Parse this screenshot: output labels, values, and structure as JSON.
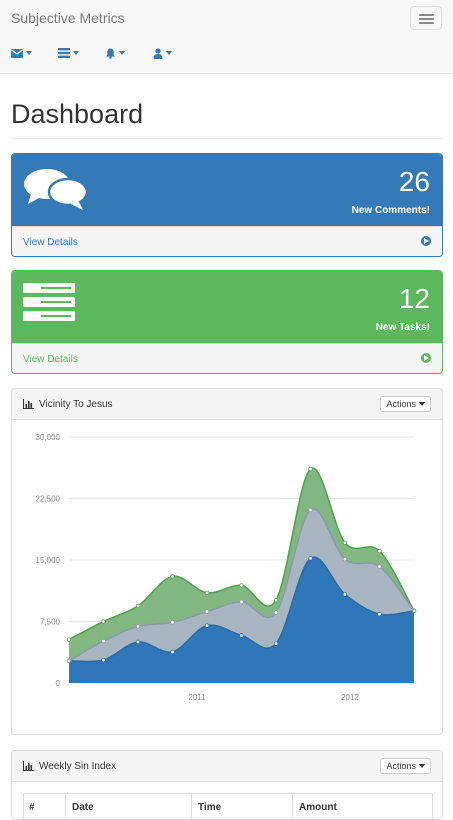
{
  "app": {
    "brand": "Subjective Metrics"
  },
  "nav": {
    "icons": [
      "envelope-icon",
      "tasks-icon",
      "bell-icon",
      "user-icon"
    ]
  },
  "page": {
    "title": "Dashboard"
  },
  "cards": [
    {
      "count": "26",
      "label": "New Comments!",
      "link": "View Details",
      "icon": "comments-icon"
    },
    {
      "count": "12",
      "label": "New Tasks!",
      "link": "View Details",
      "icon": "tasks-icon"
    }
  ],
  "chart_panel": {
    "title": "Vicinity To Jesus",
    "actions_label": "Actions"
  },
  "table_panel": {
    "title": "Weekly Sin Index",
    "actions_label": "Actions",
    "columns": [
      "#",
      "Date",
      "Time",
      "Amount"
    ]
  },
  "colors": {
    "blue": "#337ab7",
    "green": "#5cb85c",
    "area_top": "#7cb47c",
    "area_mid": "#a9b5c3",
    "area_base": "#2f77b8"
  },
  "chart_data": {
    "type": "area",
    "stacked": true,
    "ylim": [
      0,
      30000
    ],
    "yticks": [
      "0",
      "7,500",
      "15,000",
      "22,500",
      "30,000"
    ],
    "xticks": [
      "2011",
      "2012"
    ],
    "grid": true,
    "x": [
      "2010 Q1",
      "2010 Q2",
      "2010 Q3",
      "2010 Q4",
      "2011 Q1",
      "2011 Q2",
      "2011 Q3",
      "2011 Q4",
      "2012 Q1",
      "2012 Q2",
      "2012 Q3"
    ],
    "series": [
      {
        "values": [
          2700,
          2800,
          5000,
          3800,
          7000,
          5800,
          4800,
          15200,
          10800,
          8400,
          8800
        ]
      },
      {
        "values": [
          0,
          2300,
          1900,
          3600,
          1700,
          4100,
          3800,
          5900,
          4300,
          5800,
          0
        ]
      },
      {
        "values": [
          2600,
          2400,
          2500,
          5600,
          2300,
          2000,
          1500,
          5000,
          2000,
          1900,
          0
        ]
      }
    ]
  }
}
